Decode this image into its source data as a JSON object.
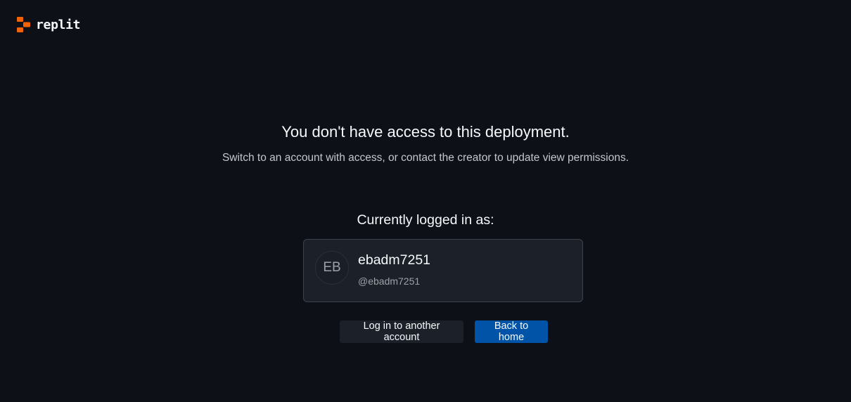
{
  "brand": {
    "name": "replit",
    "accent_color": "#f26207"
  },
  "message": {
    "title": "You don't have access to this deployment.",
    "subtitle": "Switch to an account with access, or contact the creator to update view permissions."
  },
  "account": {
    "label": "Currently logged in as:",
    "initials": "EB",
    "display_name": "ebadm7251",
    "handle": "@ebadm7251"
  },
  "actions": {
    "login_other_label": "Log in to another account",
    "back_home_label": "Back to home"
  },
  "colors": {
    "background": "#0e1017",
    "card": "#1c2029",
    "primary_button": "#0053a6"
  }
}
